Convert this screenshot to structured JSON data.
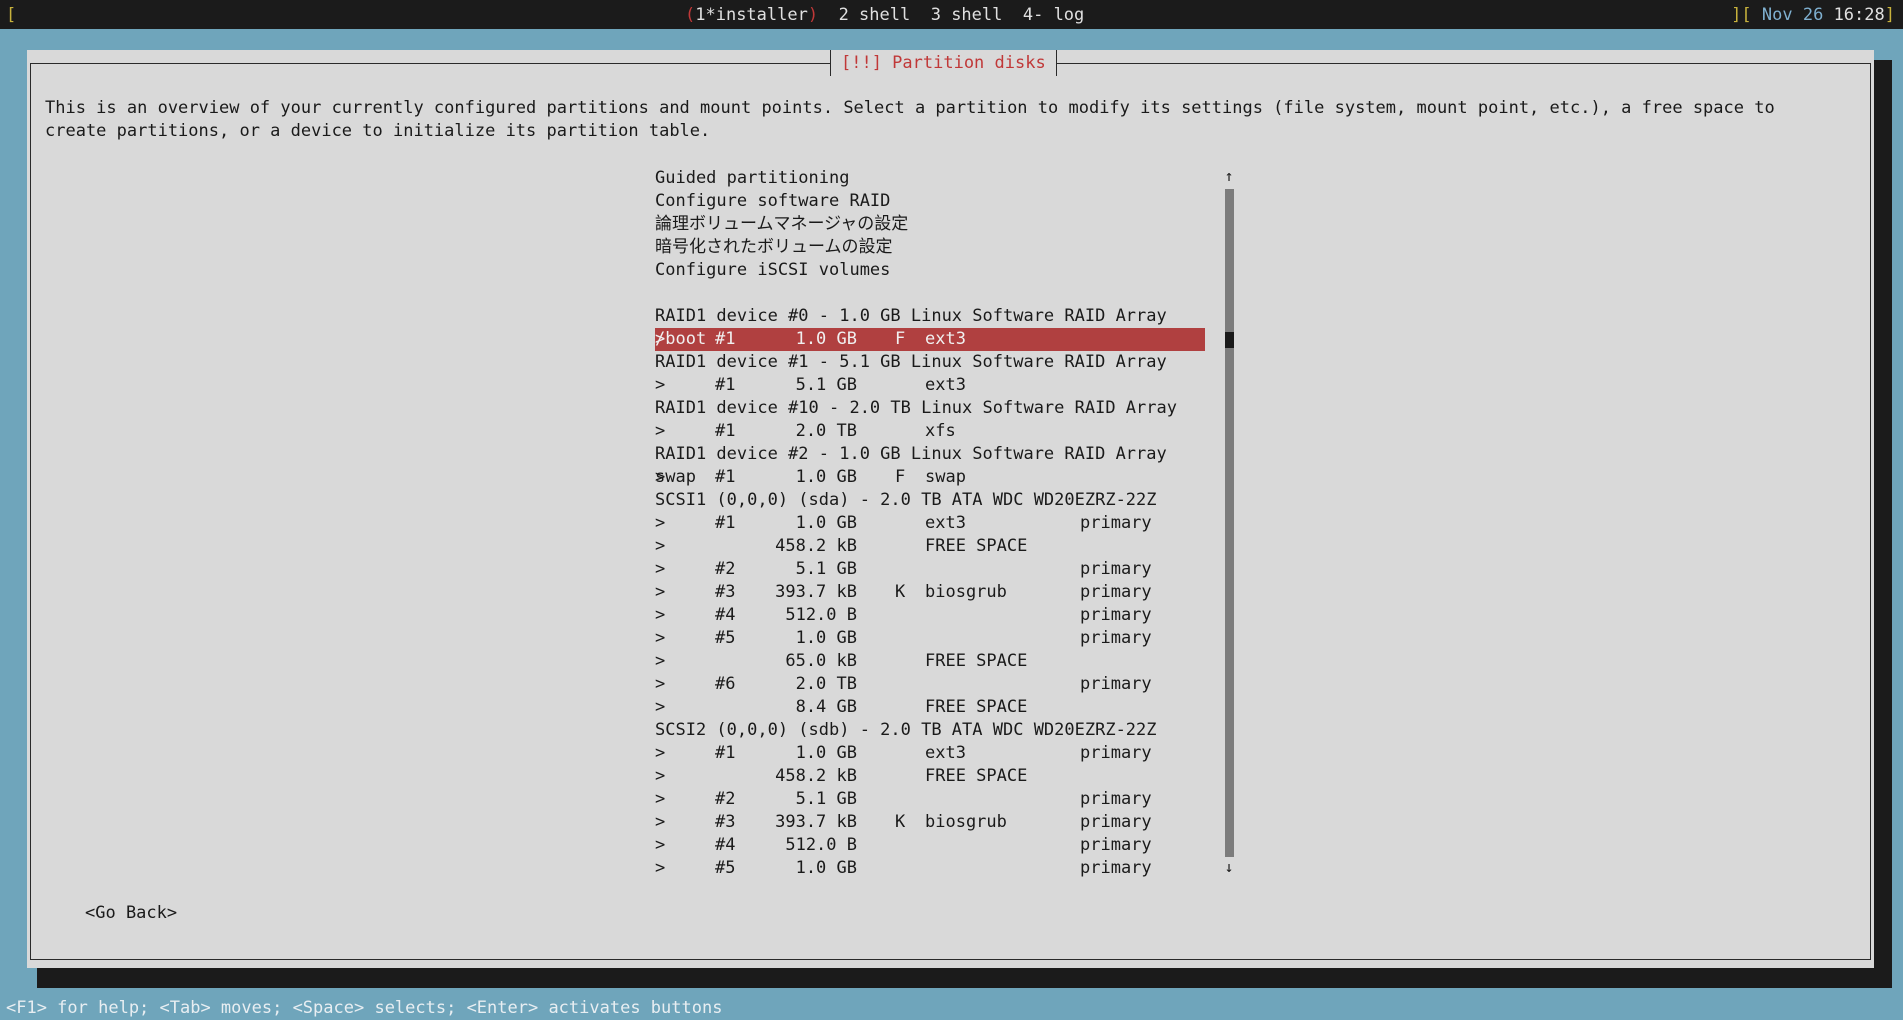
{
  "screen_bar": {
    "left_bracket": "[",
    "windows": [
      {
        "label": "1*installer",
        "active": true
      },
      {
        "label": "2 shell"
      },
      {
        "label": "3 shell"
      },
      {
        "label": "4- log"
      }
    ],
    "right_open": "][",
    "date": "Nov 26",
    "time": "16:28",
    "right_close": "]"
  },
  "dialog": {
    "title": "[!!] Partition disks",
    "intro": "This is an overview of your currently configured partitions and mount points. Select a partition to modify its settings (file system, mount point, etc.), a free space to create partitions, or a device to initialize its partition table."
  },
  "menu": [
    "Guided partitioning",
    "Configure software RAID",
    "論理ボリュームマネージャの設定",
    "暗号化されたボリュームの設定",
    "Configure iSCSI volumes"
  ],
  "devices": [
    {
      "label": "RAID1 device #0 - 1.0 GB Linux Software RAID Array",
      "partitions": [
        {
          "mark": ">",
          "num": "#1",
          "size": "1.0 GB",
          "flag": "F",
          "fs": "ext3",
          "type": "",
          "mount": "/boot",
          "selected": true
        }
      ]
    },
    {
      "label": "RAID1 device #1 - 5.1 GB Linux Software RAID Array",
      "partitions": [
        {
          "mark": ">",
          "num": "#1",
          "size": "5.1 GB",
          "flag": "",
          "fs": "ext3",
          "type": "",
          "mount": ""
        }
      ]
    },
    {
      "label": "RAID1 device #10 - 2.0 TB Linux Software RAID Array",
      "partitions": [
        {
          "mark": ">",
          "num": "#1",
          "size": "2.0 TB",
          "flag": "",
          "fs": "xfs",
          "type": "",
          "mount": ""
        }
      ]
    },
    {
      "label": "RAID1 device #2 - 1.0 GB Linux Software RAID Array",
      "partitions": [
        {
          "mark": ">",
          "num": "#1",
          "size": "1.0 GB",
          "flag": "F",
          "fs": "swap",
          "type": "",
          "mount": "swap"
        }
      ]
    },
    {
      "label": "SCSI1 (0,0,0) (sda) - 2.0 TB ATA WDC WD20EZRZ-22Z",
      "partitions": [
        {
          "mark": ">",
          "num": "#1",
          "size": "1.0 GB",
          "flag": "",
          "fs": "ext3",
          "type": "primary",
          "mount": ""
        },
        {
          "mark": ">",
          "num": "",
          "size": "458.2 kB",
          "flag": "",
          "fs": "FREE SPACE",
          "type": "",
          "mount": ""
        },
        {
          "mark": ">",
          "num": "#2",
          "size": "5.1 GB",
          "flag": "",
          "fs": "",
          "type": "primary",
          "mount": ""
        },
        {
          "mark": ">",
          "num": "#3",
          "size": "393.7 kB",
          "flag": "K",
          "fs": "biosgrub",
          "type": "primary",
          "mount": ""
        },
        {
          "mark": ">",
          "num": "#4",
          "size": "512.0 B",
          "flag": "",
          "fs": "",
          "type": "primary",
          "mount": ""
        },
        {
          "mark": ">",
          "num": "#5",
          "size": "1.0 GB",
          "flag": "",
          "fs": "",
          "type": "primary",
          "mount": ""
        },
        {
          "mark": ">",
          "num": "",
          "size": "65.0 kB",
          "flag": "",
          "fs": "FREE SPACE",
          "type": "",
          "mount": ""
        },
        {
          "mark": ">",
          "num": "#6",
          "size": "2.0 TB",
          "flag": "",
          "fs": "",
          "type": "primary",
          "mount": ""
        },
        {
          "mark": ">",
          "num": "",
          "size": "8.4 GB",
          "flag": "",
          "fs": "FREE SPACE",
          "type": "",
          "mount": ""
        }
      ]
    },
    {
      "label": "SCSI2 (0,0,0) (sdb) - 2.0 TB ATA WDC WD20EZRZ-22Z",
      "partitions": [
        {
          "mark": ">",
          "num": "#1",
          "size": "1.0 GB",
          "flag": "",
          "fs": "ext3",
          "type": "primary",
          "mount": ""
        },
        {
          "mark": ">",
          "num": "",
          "size": "458.2 kB",
          "flag": "",
          "fs": "FREE SPACE",
          "type": "",
          "mount": ""
        },
        {
          "mark": ">",
          "num": "#2",
          "size": "5.1 GB",
          "flag": "",
          "fs": "",
          "type": "primary",
          "mount": ""
        },
        {
          "mark": ">",
          "num": "#3",
          "size": "393.7 kB",
          "flag": "K",
          "fs": "biosgrub",
          "type": "primary",
          "mount": ""
        },
        {
          "mark": ">",
          "num": "#4",
          "size": "512.0 B",
          "flag": "",
          "fs": "",
          "type": "primary",
          "mount": ""
        },
        {
          "mark": ">",
          "num": "#5",
          "size": "1.0 GB",
          "flag": "",
          "fs": "",
          "type": "primary",
          "mount": ""
        }
      ]
    }
  ],
  "scrollbar": {
    "up": "↑",
    "down": "↓"
  },
  "buttons": {
    "go_back": "<Go Back>"
  },
  "help": "<F1> for help; <Tab> moves; <Space> selects; <Enter> activates buttons",
  "colors": {
    "background": "#6fa5bb",
    "dialog": "#d9d9d9",
    "title_red": "#c03838",
    "selection": "#b04040",
    "bar": "#1b1b1b"
  }
}
